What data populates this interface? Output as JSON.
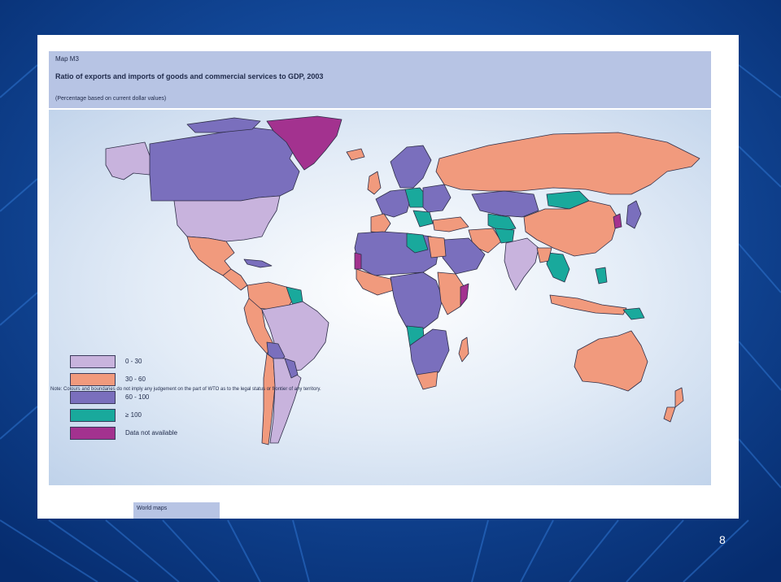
{
  "map": {
    "label": "Map M3",
    "title": "Ratio of exports and imports of goods and commercial services to GDP, 2003",
    "subtitle": "(Percentage based on current dollar values)"
  },
  "colors": {
    "c0_30": "#c8b3dd",
    "c30_60": "#f19a7d",
    "c60_100": "#7a6fbd",
    "c100": "#19a99c",
    "na": "#a3328f",
    "border": "#2e2e48",
    "panel_header": "#b7c4e4",
    "slide_bg": "#0a3f8c"
  },
  "legend": [
    {
      "label": "0 - 30",
      "key": "c0_30"
    },
    {
      "label": "30 - 60",
      "key": "c30_60"
    },
    {
      "label": "60 - 100",
      "key": "c60_100"
    },
    {
      "label": "≥ 100",
      "key": "c100"
    },
    {
      "label": "Data not available",
      "key": "na"
    }
  ],
  "note": "Note: Colours and boundaries do not imply any judgement on the part of WTO as to the legal status or frontier of any territory.",
  "footer": {
    "tab": "World maps"
  },
  "slide": {
    "number": "8"
  }
}
